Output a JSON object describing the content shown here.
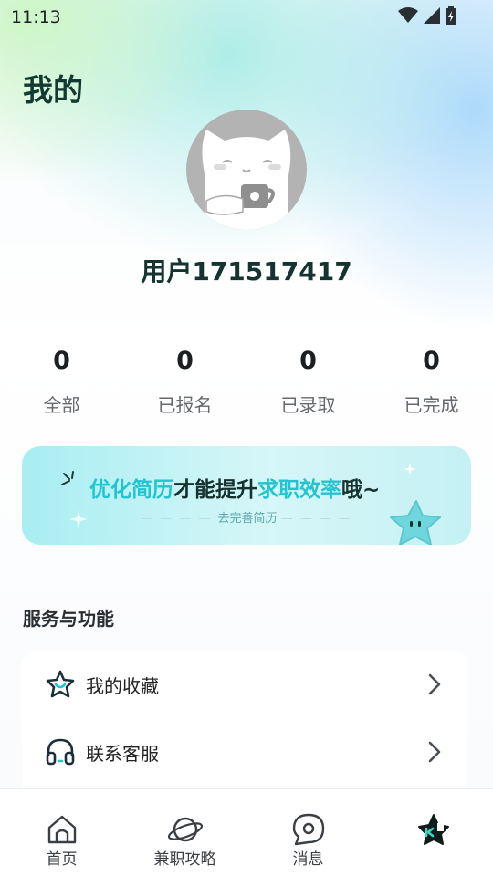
{
  "status_bar": {
    "time": "11:13"
  },
  "page": {
    "title": "我的"
  },
  "profile": {
    "username": "用户171517417"
  },
  "stats": [
    {
      "value": "0",
      "label": "全部"
    },
    {
      "value": "0",
      "label": "已报名"
    },
    {
      "value": "0",
      "label": "已录取"
    },
    {
      "value": "0",
      "label": "已完成"
    }
  ],
  "banner": {
    "part1": "优化简历",
    "part2": "才能提升",
    "part3": "求职效率",
    "part4": "哦~",
    "subtitle": "去完善简历",
    "accent_color": "#22c4d0"
  },
  "services": {
    "title": "服务与功能",
    "items": [
      {
        "label": "我的收藏",
        "icon": "star-icon"
      },
      {
        "label": "联系客服",
        "icon": "headset-icon"
      }
    ]
  },
  "tabs": [
    {
      "label": "首页",
      "icon": "home-icon"
    },
    {
      "label": "兼职攻略",
      "icon": "planet-icon"
    },
    {
      "label": "消息",
      "icon": "message-icon"
    },
    {
      "label": "",
      "icon": "profile-icon",
      "active": true
    }
  ]
}
